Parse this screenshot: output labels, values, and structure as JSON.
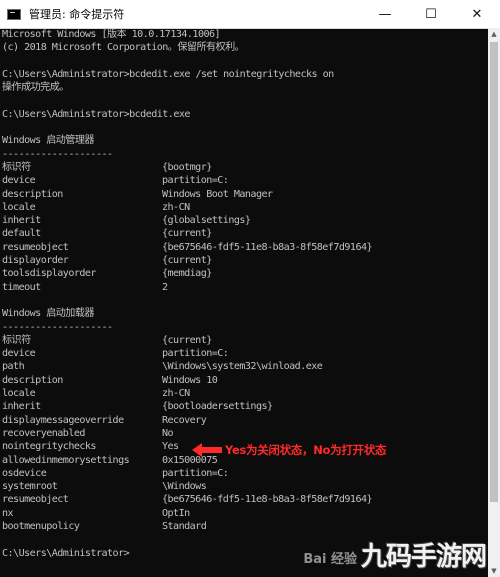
{
  "window": {
    "title": "管理员: 命令提示符",
    "minimize_glyph": "—",
    "maximize_glyph": "☐",
    "close_glyph": "✕"
  },
  "console": {
    "lines": [
      {
        "text": "Microsoft Windows [版本 10.0.17134.1006]"
      },
      {
        "text": "(c) 2018 Microsoft Corporation。保留所有权利。"
      },
      {
        "text": ""
      },
      {
        "text": "C:\\Users\\Administrator>bcdedit.exe /set nointegritychecks on"
      },
      {
        "text": "操作成功完成。"
      },
      {
        "text": ""
      },
      {
        "text": "C:\\Users\\Administrator>bcdedit.exe"
      },
      {
        "text": ""
      },
      {
        "text": "Windows 启动管理器"
      },
      {
        "text": "--------------------"
      },
      {
        "key": "标识符",
        "value": "{bootmgr}"
      },
      {
        "key": "device",
        "value": "partition=C:"
      },
      {
        "key": "description",
        "value": "Windows Boot Manager"
      },
      {
        "key": "locale",
        "value": "zh-CN"
      },
      {
        "key": "inherit",
        "value": "{globalsettings}"
      },
      {
        "key": "default",
        "value": "{current}"
      },
      {
        "key": "resumeobject",
        "value": "{be675646-fdf5-11e8-b8a3-8f58ef7d9164}"
      },
      {
        "key": "displayorder",
        "value": "{current}"
      },
      {
        "key": "toolsdisplayorder",
        "value": "{memdiag}"
      },
      {
        "key": "timeout",
        "value": "2"
      },
      {
        "text": ""
      },
      {
        "text": "Windows 启动加载器"
      },
      {
        "text": "--------------------"
      },
      {
        "key": "标识符",
        "value": "{current}"
      },
      {
        "key": "device",
        "value": "partition=C:"
      },
      {
        "key": "path",
        "value": "\\Windows\\system32\\winload.exe"
      },
      {
        "key": "description",
        "value": "Windows 10"
      },
      {
        "key": "locale",
        "value": "zh-CN"
      },
      {
        "key": "inherit",
        "value": "{bootloadersettings}"
      },
      {
        "key": "displaymessageoverride",
        "value": "Recovery"
      },
      {
        "key": "recoveryenabled",
        "value": "No"
      },
      {
        "key": "nointegritychecks",
        "value": "Yes"
      },
      {
        "key": "allowedinmemorysettings",
        "value": "0x15000075"
      },
      {
        "key": "osdevice",
        "value": "partition=C:"
      },
      {
        "key": "systemroot",
        "value": "\\Windows"
      },
      {
        "key": "resumeobject",
        "value": "{be675646-fdf5-11e8-b8a3-8f58ef7d9164}"
      },
      {
        "key": "nx",
        "value": "OptIn"
      },
      {
        "key": "bootmenupolicy",
        "value": "Standard"
      },
      {
        "text": ""
      },
      {
        "text": "C:\\Users\\Administrator>"
      }
    ]
  },
  "annotation": {
    "text": "Yes为关闭状态，No为打开状态",
    "color": "#ff2a2a"
  },
  "watermark": {
    "baidu": "Bai 经验",
    "site": "九码手游网"
  },
  "colors": {
    "console_bg": "#0c0c0c",
    "console_text": "#c0c0c0"
  }
}
